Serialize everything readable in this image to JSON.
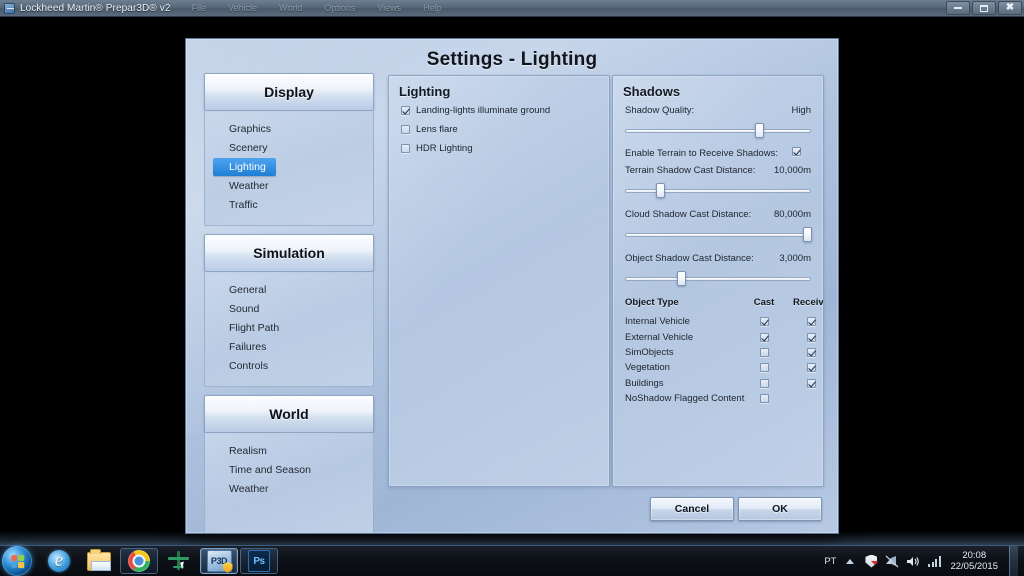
{
  "window": {
    "title": "Lockheed Martin® Prepar3D® v2",
    "icon": "app-icon",
    "menu": [
      "File",
      "Vehicle",
      "World",
      "Options",
      "Views",
      "Help"
    ],
    "controls": {
      "minimize": "minimize-icon",
      "maximize": "restore-icon",
      "close": "close-icon"
    }
  },
  "dialog": {
    "title": "Settings - Lighting",
    "buttons": {
      "cancel": "Cancel",
      "ok": "OK"
    }
  },
  "nav": {
    "groups": [
      {
        "header": "Display",
        "items": [
          {
            "label": "Graphics",
            "selected": false
          },
          {
            "label": "Scenery",
            "selected": false
          },
          {
            "label": "Lighting",
            "selected": true
          },
          {
            "label": "Weather",
            "selected": false
          },
          {
            "label": "Traffic",
            "selected": false
          }
        ]
      },
      {
        "header": "Simulation",
        "items": [
          {
            "label": "General",
            "selected": false
          },
          {
            "label": "Sound",
            "selected": false
          },
          {
            "label": "Flight Path",
            "selected": false
          },
          {
            "label": "Failures",
            "selected": false
          },
          {
            "label": "Controls",
            "selected": false
          }
        ]
      },
      {
        "header": "World",
        "items": [
          {
            "label": "Realism",
            "selected": false
          },
          {
            "label": "Time and Season",
            "selected": false
          },
          {
            "label": "Weather",
            "selected": false
          }
        ]
      }
    ]
  },
  "lighting": {
    "title": "Lighting",
    "options": [
      {
        "label": "Landing-lights illuminate ground",
        "checked": true
      },
      {
        "label": "Lens flare",
        "checked": false
      },
      {
        "label": "HDR Lighting",
        "checked": false
      }
    ]
  },
  "shadows": {
    "title": "Shadows",
    "quality": {
      "label": "Shadow Quality:",
      "value": "High",
      "slider_pct": 72
    },
    "terrain_receive": {
      "label": "Enable Terrain to Receive Shadows:",
      "checked": true
    },
    "terrain_distance": {
      "label": "Terrain Shadow Cast Distance:",
      "value": "10,000m",
      "slider_pct": 19
    },
    "cloud_distance": {
      "label": "Cloud Shadow Cast Distance:",
      "value": "80,000m",
      "slider_pct": 98
    },
    "object_distance": {
      "label": "Object Shadow Cast Distance:",
      "value": "3,000m",
      "slider_pct": 30
    },
    "table": {
      "headers": [
        "Object Type",
        "Cast",
        "Receive"
      ],
      "rows": [
        {
          "type": "Internal Vehicle",
          "cast": true,
          "receive": true,
          "cast_visible": true,
          "receive_visible": true
        },
        {
          "type": "External Vehicle",
          "cast": true,
          "receive": true,
          "cast_visible": true,
          "receive_visible": true
        },
        {
          "type": "SimObjects",
          "cast": false,
          "receive": true,
          "cast_visible": true,
          "receive_visible": true
        },
        {
          "type": "Vegetation",
          "cast": false,
          "receive": true,
          "cast_visible": true,
          "receive_visible": true
        },
        {
          "type": "Buildings",
          "cast": false,
          "receive": true,
          "cast_visible": true,
          "receive_visible": true
        },
        {
          "type": "NoShadow Flagged Content",
          "cast": false,
          "receive": false,
          "cast_visible": true,
          "receive_visible": false
        }
      ]
    }
  },
  "taskbar": {
    "start": "windows-start-orb",
    "apps": [
      {
        "name": "internet-explorer",
        "state": "pinned"
      },
      {
        "name": "file-explorer",
        "state": "pinned"
      },
      {
        "name": "google-chrome",
        "state": "running"
      },
      {
        "name": "flight-simulator",
        "state": "running"
      },
      {
        "name": "prepar3d",
        "state": "active"
      },
      {
        "name": "photoshop",
        "state": "running"
      }
    ],
    "tray": {
      "language": "PT",
      "icons": [
        "show-hidden-icons",
        "antivirus-shield-icon",
        "network-muted-icon",
        "volume-icon",
        "signal-strength-icon"
      ],
      "time": "20:08",
      "date": "22/05/2015"
    }
  },
  "colors": {
    "accent": "#1e7fd6",
    "dialog_bg": "#b4c7e2",
    "panel_bg": "#c0d0e7",
    "taskbar": "#0e1218"
  }
}
